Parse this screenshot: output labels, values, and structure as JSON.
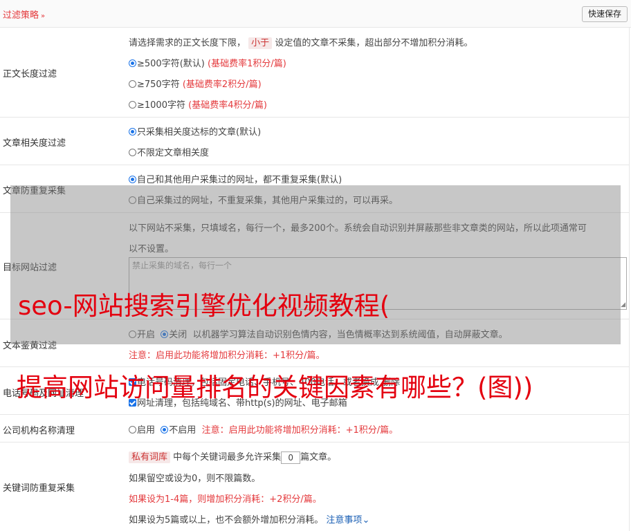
{
  "header": {
    "title": "过滤策略",
    "chevron_icon": "double-chevron-down",
    "save_label": "快速保存"
  },
  "length_filter": {
    "label": "正文长度过滤",
    "desc_before": "请选择需求的正文长度下限，",
    "desc_tag": "小于",
    "desc_after": "设定值的文章不采集，超出部分不增加积分消耗。",
    "options": [
      {
        "text": "≥500字符(默认)",
        "note": "(基础费率1积分/篇)",
        "checked": true
      },
      {
        "text": "≥750字符",
        "note": "(基础费率2积分/篇)",
        "checked": false
      },
      {
        "text": "≥1000字符",
        "note": "(基础费率4积分/篇)",
        "checked": false
      }
    ]
  },
  "relevance": {
    "label": "文章相关度过滤",
    "options": [
      {
        "text": "只采集相关度达标的文章(默认)",
        "checked": true
      },
      {
        "text": "不限定文章相关度",
        "checked": false
      }
    ]
  },
  "dedupe": {
    "label": "文章防重复采集",
    "options": [
      {
        "text": "自己和其他用户采集过的网址，都不重复采集(默认)",
        "checked": true
      },
      {
        "text": "自己采集过的网址，不重复采集，其他用户采集过的，可以再采。",
        "checked": false
      }
    ]
  },
  "site_filter": {
    "label": "目标网站过滤",
    "desc_line1": "以下网站不采集，只填域名，每行一个，最多200个。系统会自动识别并屏蔽那些非文章类的网站，所以此项通常可",
    "desc_line2": "以不设置。",
    "placeholder": "禁止采集的域名，每行一个"
  },
  "porn_filter": {
    "label": "文本鉴黄过滤",
    "opt_on": "开启",
    "opt_off": "关闭",
    "desc": "以机器学习算法自动识别色情内容，当色情概率达到系统阈值，自动屏蔽文章。",
    "warning": "注意：启用此功能将增加积分消耗：+1积分/篇。"
  },
  "phone_clean": {
    "label": "电话号码及网址清理",
    "line1": "电话号码清理，包括固定电话、手机号、400电话。或者换成",
    "line1_end": "删除",
    "line2": "网址清理，包括纯域名、带http(s)的网址、电子邮箱"
  },
  "org_clean": {
    "label": "公司机构名称清理",
    "opt_on": "启用",
    "opt_off": "不启用",
    "warning": "注意：启用此功能将增加积分消耗：+1积分/篇。"
  },
  "keyword_dedupe": {
    "label": "关键词防重复采集",
    "tag": "私有词库",
    "text_before": "中每个关键词最多允许采集",
    "value": "0",
    "text_after": "篇文章。",
    "line2": "如果留空或设为0，则不限篇数。",
    "line3": "如果设为1-4篇，则增加积分消耗：+2积分/篇。",
    "line4": "如果设为5篇或以上，也不会额外增加积分消耗。",
    "link": "注意事项"
  },
  "watermark": {
    "line1": "seo-网站搜索引擎优化视频教程(",
    "line2": "提高网站访问量排名的关键因素有哪些？(图))"
  }
}
